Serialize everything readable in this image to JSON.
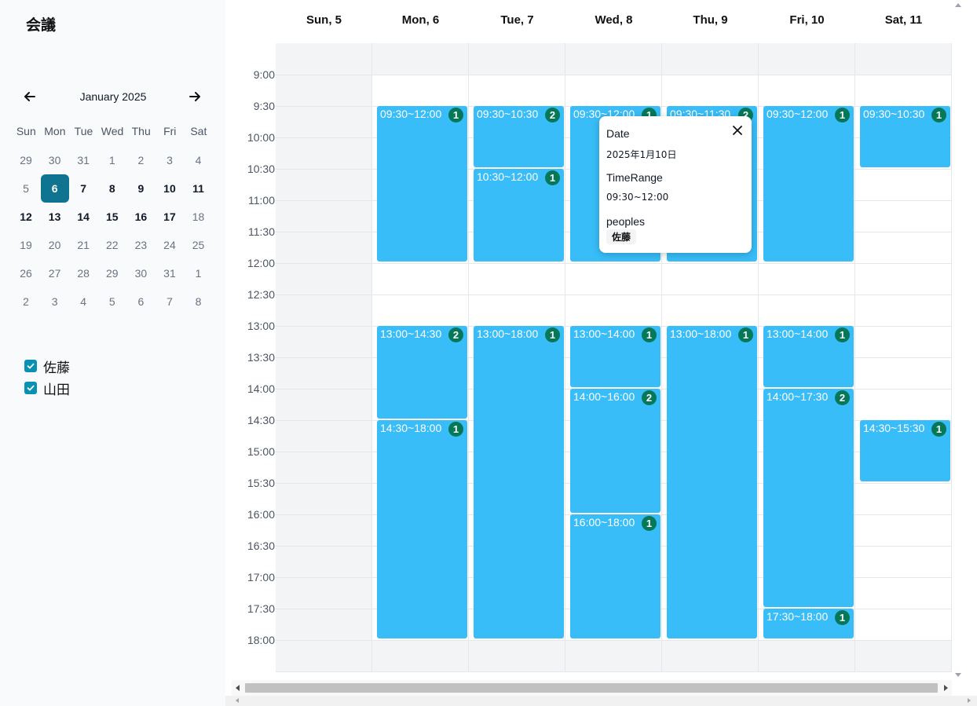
{
  "app": {
    "title": "会議"
  },
  "mini_calendar": {
    "month_label": "January 2025",
    "prev_icon": "arrow-left-icon",
    "next_icon": "arrow-right-icon",
    "weekdays": [
      "Sun",
      "Mon",
      "Tue",
      "Wed",
      "Thu",
      "Fri",
      "Sat"
    ],
    "weeks": [
      [
        {
          "d": "29",
          "t": "other"
        },
        {
          "d": "30",
          "t": "other"
        },
        {
          "d": "31",
          "t": "other"
        },
        {
          "d": "1",
          "t": "other"
        },
        {
          "d": "2",
          "t": "other"
        },
        {
          "d": "3",
          "t": "other"
        },
        {
          "d": "4",
          "t": "other"
        }
      ],
      [
        {
          "d": "5",
          "t": "weekend"
        },
        {
          "d": "6",
          "t": "selected"
        },
        {
          "d": "7",
          "t": "cur"
        },
        {
          "d": "8",
          "t": "cur"
        },
        {
          "d": "9",
          "t": "cur"
        },
        {
          "d": "10",
          "t": "cur"
        },
        {
          "d": "11",
          "t": "cur"
        }
      ],
      [
        {
          "d": "12",
          "t": "cur"
        },
        {
          "d": "13",
          "t": "cur"
        },
        {
          "d": "14",
          "t": "cur"
        },
        {
          "d": "15",
          "t": "cur"
        },
        {
          "d": "16",
          "t": "cur"
        },
        {
          "d": "17",
          "t": "cur"
        },
        {
          "d": "18",
          "t": "weekend"
        }
      ],
      [
        {
          "d": "19",
          "t": "other"
        },
        {
          "d": "20",
          "t": "other"
        },
        {
          "d": "21",
          "t": "other"
        },
        {
          "d": "22",
          "t": "other"
        },
        {
          "d": "23",
          "t": "other"
        },
        {
          "d": "24",
          "t": "other"
        },
        {
          "d": "25",
          "t": "other"
        }
      ],
      [
        {
          "d": "26",
          "t": "other"
        },
        {
          "d": "27",
          "t": "other"
        },
        {
          "d": "28",
          "t": "other"
        },
        {
          "d": "29",
          "t": "other"
        },
        {
          "d": "30",
          "t": "other"
        },
        {
          "d": "31",
          "t": "other"
        },
        {
          "d": "1",
          "t": "other"
        }
      ],
      [
        {
          "d": "2",
          "t": "other"
        },
        {
          "d": "3",
          "t": "other"
        },
        {
          "d": "4",
          "t": "other"
        },
        {
          "d": "5",
          "t": "other"
        },
        {
          "d": "6",
          "t": "other"
        },
        {
          "d": "7",
          "t": "other"
        },
        {
          "d": "8",
          "t": "other"
        }
      ]
    ]
  },
  "filters": [
    {
      "label": "佐藤",
      "checked": true
    },
    {
      "label": "山田",
      "checked": true
    }
  ],
  "week": {
    "days": [
      "Sun, 5",
      "Mon, 6",
      "Tue, 7",
      "Wed, 8",
      "Thu, 9",
      "Fri, 10",
      "Sat, 11"
    ],
    "time_labels": [
      "9:00",
      "9:30",
      "10:00",
      "10:30",
      "11:00",
      "11:30",
      "12:00",
      "12:30",
      "13:00",
      "13:30",
      "14:00",
      "14:30",
      "15:00",
      "15:30",
      "16:00",
      "16:30",
      "17:00",
      "17:30",
      "18:00"
    ],
    "events": [
      {
        "day": 1,
        "start": "9:30",
        "end": "12:00",
        "label": "09:30~12:00",
        "count": "1"
      },
      {
        "day": 1,
        "start": "13:00",
        "end": "14:30",
        "label": "13:00~14:30",
        "count": "2"
      },
      {
        "day": 1,
        "start": "14:30",
        "end": "18:00",
        "label": "14:30~18:00",
        "count": "1"
      },
      {
        "day": 2,
        "start": "9:30",
        "end": "10:30",
        "label": "09:30~10:30",
        "count": "2"
      },
      {
        "day": 2,
        "start": "10:30",
        "end": "12:00",
        "label": "10:30~12:00",
        "count": "1"
      },
      {
        "day": 2,
        "start": "13:00",
        "end": "18:00",
        "label": "13:00~18:00",
        "count": "1"
      },
      {
        "day": 3,
        "start": "9:30",
        "end": "12:00",
        "label": "09:30~12:00",
        "count": "1"
      },
      {
        "day": 3,
        "start": "13:00",
        "end": "14:00",
        "label": "13:00~14:00",
        "count": "1"
      },
      {
        "day": 3,
        "start": "14:00",
        "end": "16:00",
        "label": "14:00~16:00",
        "count": "2"
      },
      {
        "day": 3,
        "start": "16:00",
        "end": "18:00",
        "label": "16:00~18:00",
        "count": "1"
      },
      {
        "day": 4,
        "start": "9:30",
        "end": "12:00",
        "label": "09:30~11:30",
        "count": "2"
      },
      {
        "day": 4,
        "start": "13:00",
        "end": "18:00",
        "label": "13:00~18:00",
        "count": "1"
      },
      {
        "day": 5,
        "start": "9:30",
        "end": "12:00",
        "label": "09:30~12:00",
        "count": "1"
      },
      {
        "day": 5,
        "start": "13:00",
        "end": "14:00",
        "label": "13:00~14:00",
        "count": "1"
      },
      {
        "day": 5,
        "start": "14:00",
        "end": "17:30",
        "label": "14:00~17:30",
        "count": "2"
      },
      {
        "day": 5,
        "start": "17:30",
        "end": "18:00",
        "label": "17:30~18:00",
        "count": "1"
      },
      {
        "day": 6,
        "start": "9:30",
        "end": "10:30",
        "label": "09:30~10:30",
        "count": "1"
      },
      {
        "day": 6,
        "start": "14:30",
        "end": "15:30",
        "label": "14:30~15:30",
        "count": "1"
      }
    ]
  },
  "popover": {
    "date_label": "Date",
    "date_value": "2025年1月10日",
    "time_label": "TimeRange",
    "time_value": "09:30~12:00",
    "people_label": "peoples",
    "people": [
      "佐藤"
    ],
    "close_icon": "close-icon"
  },
  "colors": {
    "event": "#38bdf8",
    "badge": "#047857",
    "selected_day": "#0e7490",
    "checkbox": "#0891b2"
  }
}
